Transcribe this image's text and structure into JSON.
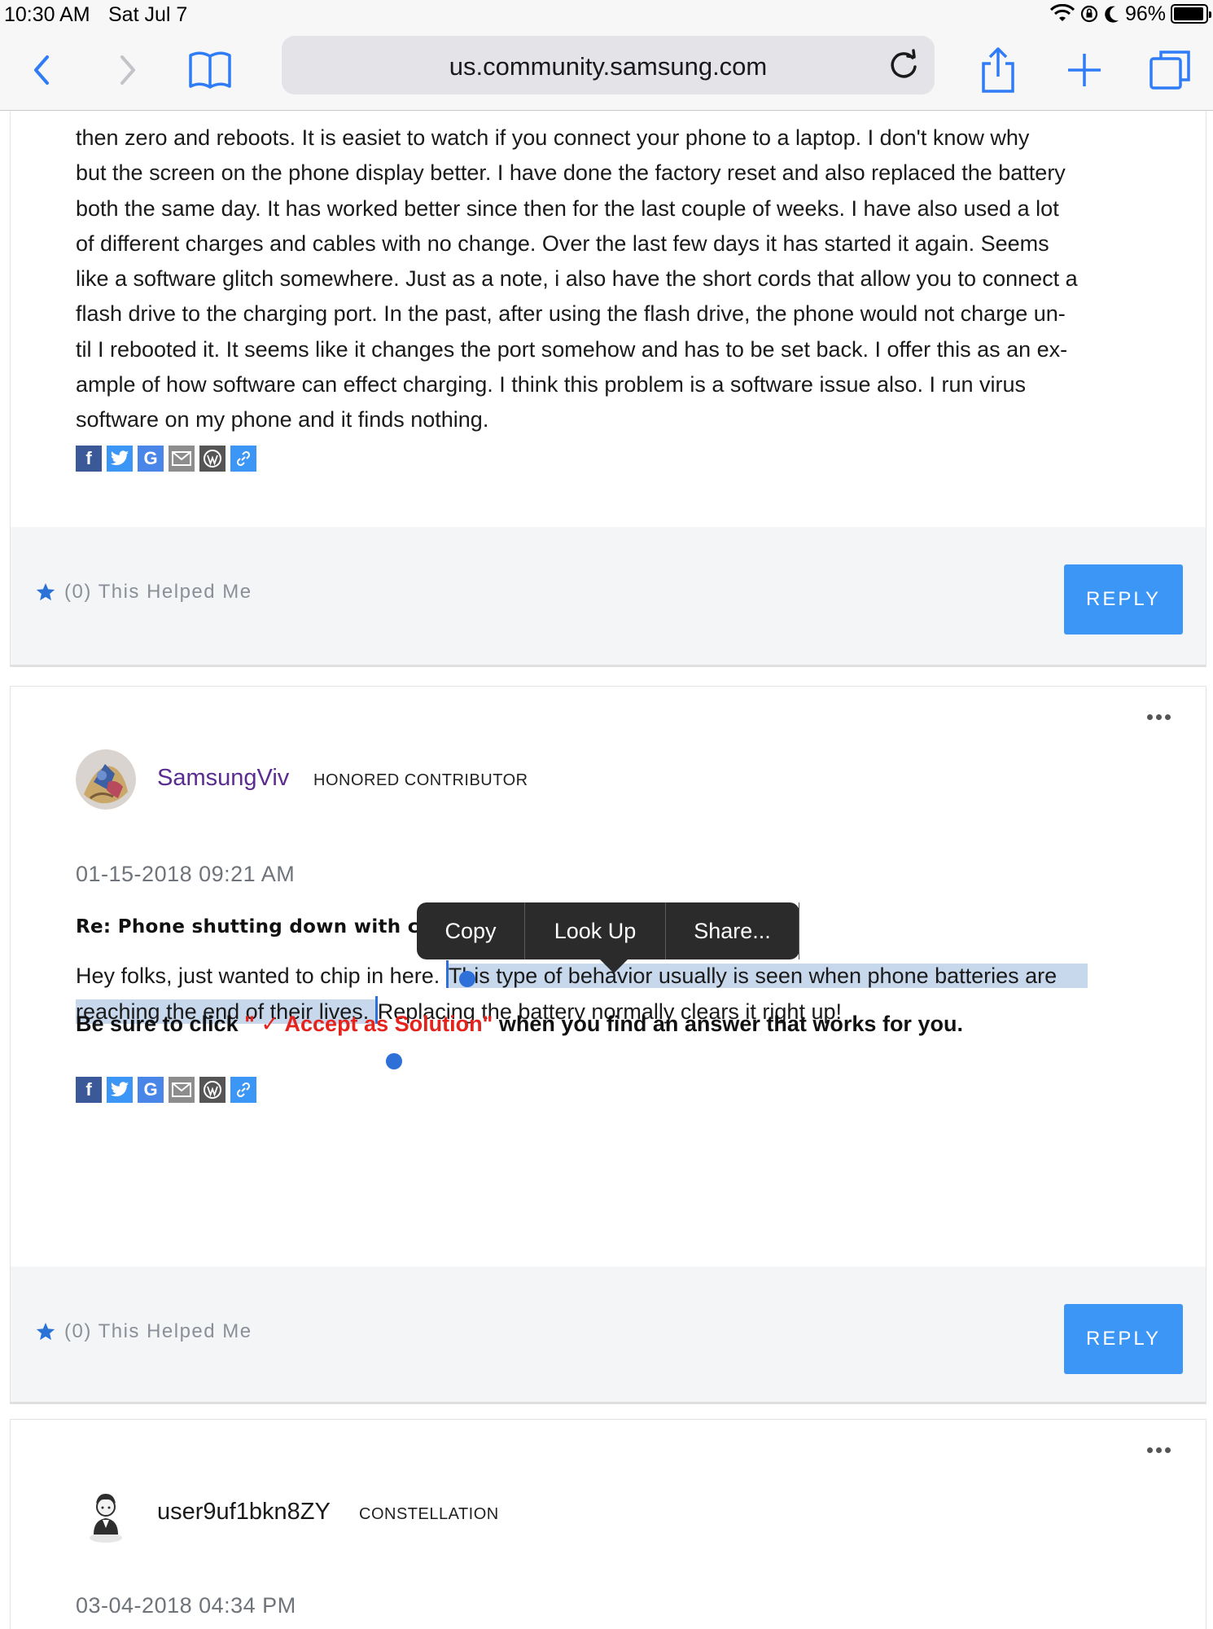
{
  "status_bar": {
    "time": "10:30 AM",
    "date": "Sat Jul 7",
    "battery_percent": "96%",
    "battery_level": 0.96
  },
  "toolbar": {
    "url": "us.community.samsung.com",
    "icons": [
      "back-icon",
      "forward-icon",
      "bookmarks-icon",
      "reload-icon",
      "share-icon",
      "new-tab-icon",
      "tabs-icon"
    ]
  },
  "post1": {
    "lines": [
      "then zero and reboots.  It is easiet to watch if you connect your phone to a laptop.  I don't know why",
      "but the screen on the phone display better.  I have done the factory reset and also replaced the battery",
      "both the same day.  It has worked better since then for the last couple of weeks.  I have also used a lot",
      "of different charges and cables with no change.  Over the last few days it has started it again.  Seems",
      "like a software glitch somewhere.  Just as a note, i also have the short cords that allow you to connect a",
      "flash drive to the charging port.  In the past, after using the flash drive, the phone would not charge un-",
      "til I rebooted it.  It seems like it changes the port somehow and has to be set back.  I offer this as an ex-",
      "ample of how software can effect charging.  I think this problem is a software issue also.  I run virus",
      "software on my phone and it finds nothing."
    ],
    "helped": "(0) This Helped Me",
    "reply": "REPLY"
  },
  "post2": {
    "author": "SamsungViv",
    "rank": "HONORED CONTRIBUTOR",
    "date": "01-15-2018 09:21 AM",
    "subject": "Re: Phone shutting down with charg",
    "body_plain_1": "Hey folks, just wanted to chip in here. ",
    "body_selected_1": "This type of behavior usually is seen when phone batteries are",
    "body_selected_2": "reaching the end of their lives. ",
    "body_plain_2": "Replacing the battery normally clears it right up!",
    "cta_before": "Be sure to click ",
    "cta_red": "\" ✓ Accept as Solution\"",
    "cta_after": " when you find an answer that works for you.",
    "helped": "(0) This Helped Me",
    "reply": "REPLY"
  },
  "post3": {
    "author": "user9uf1bkn8ZY",
    "rank": "CONSTELLATION",
    "date": "03-04-2018 04:34 PM"
  },
  "edit_menu": {
    "items": [
      "Copy",
      "Look Up",
      "Share..."
    ]
  },
  "colors": {
    "accent": "#3c96f5",
    "author_purple": "#5b2c8f",
    "selection": "#c7d7ec",
    "cta_red": "#e3231c",
    "safari_blue": "#2f7cf6"
  }
}
